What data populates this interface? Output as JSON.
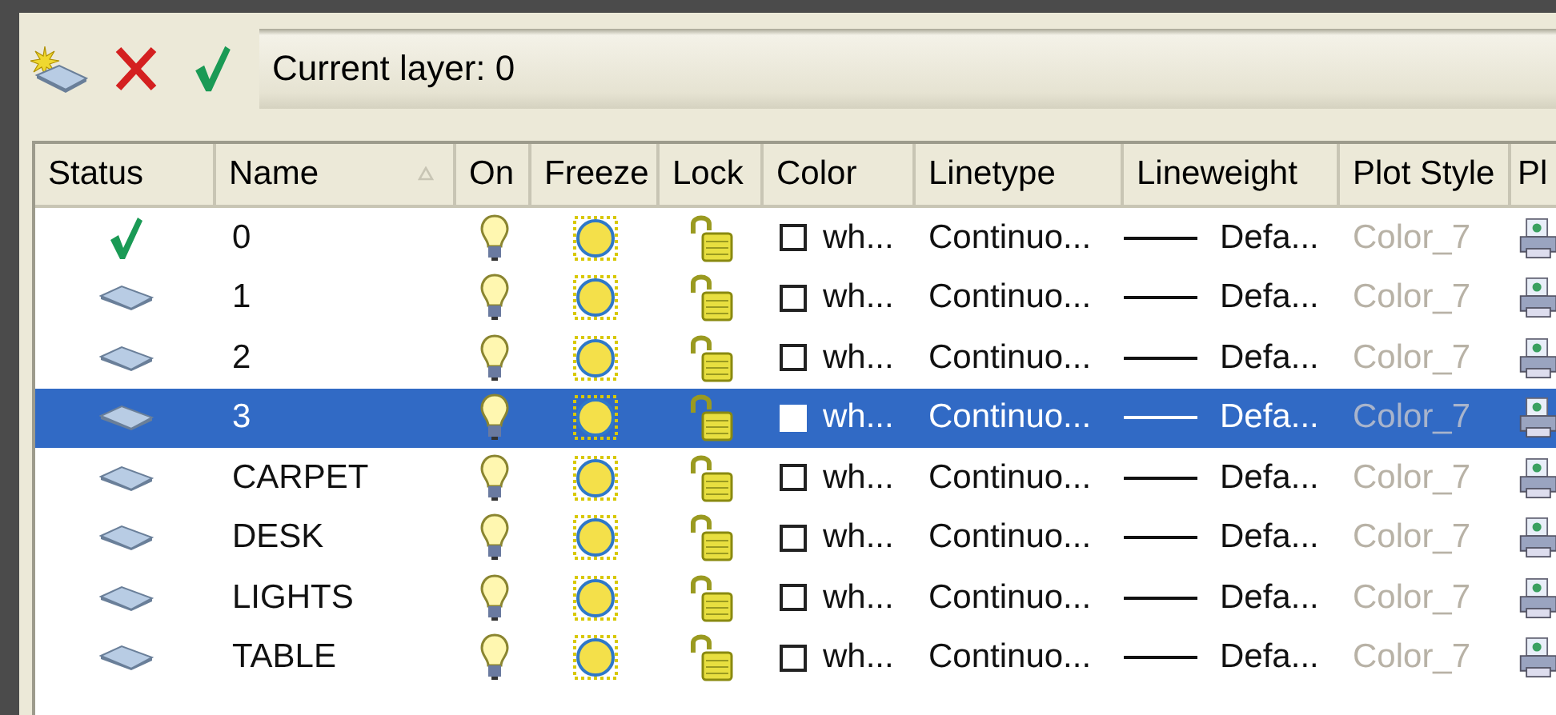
{
  "toolbar": {
    "current_layer": "Current layer: 0"
  },
  "table": {
    "columns": [
      {
        "label": "Status"
      },
      {
        "label": "Name",
        "sorted": true
      },
      {
        "label": "On"
      },
      {
        "label": "Freeze"
      },
      {
        "label": "Lock"
      },
      {
        "label": "Color"
      },
      {
        "label": "Linetype"
      },
      {
        "label": "Lineweight"
      },
      {
        "label": "Plot Style"
      },
      {
        "label": "Pl"
      }
    ],
    "rows": [
      {
        "kind": "current",
        "name": "0",
        "on": true,
        "frozen": false,
        "locked": false,
        "color_name": "wh...",
        "linetype": "Continuo...",
        "lineweight": "Defa...",
        "plot_style": "Color_7",
        "selected": false
      },
      {
        "kind": "layer",
        "name": "1",
        "on": true,
        "frozen": false,
        "locked": false,
        "color_name": "wh...",
        "linetype": "Continuo...",
        "lineweight": "Defa...",
        "plot_style": "Color_7",
        "selected": false
      },
      {
        "kind": "layer",
        "name": "2",
        "on": true,
        "frozen": false,
        "locked": false,
        "color_name": "wh...",
        "linetype": "Continuo...",
        "lineweight": "Defa...",
        "plot_style": "Color_7",
        "selected": false
      },
      {
        "kind": "layer",
        "name": "3",
        "on": true,
        "frozen": false,
        "locked": false,
        "color_name": "wh...",
        "linetype": "Continuo...",
        "lineweight": "Defa...",
        "plot_style": "Color_7",
        "selected": true
      },
      {
        "kind": "layer",
        "name": "CARPET",
        "on": true,
        "frozen": false,
        "locked": false,
        "color_name": "wh...",
        "linetype": "Continuo...",
        "lineweight": "Defa...",
        "plot_style": "Color_7",
        "selected": false
      },
      {
        "kind": "layer",
        "name": "DESK",
        "on": true,
        "frozen": false,
        "locked": false,
        "color_name": "wh...",
        "linetype": "Continuo...",
        "lineweight": "Defa...",
        "plot_style": "Color_7",
        "selected": false
      },
      {
        "kind": "layer",
        "name": "LIGHTS",
        "on": true,
        "frozen": false,
        "locked": false,
        "color_name": "wh...",
        "linetype": "Continuo...",
        "lineweight": "Defa...",
        "plot_style": "Color_7",
        "selected": false
      },
      {
        "kind": "layer",
        "name": "TABLE",
        "on": true,
        "frozen": false,
        "locked": false,
        "color_name": "wh...",
        "linetype": "Continuo...",
        "lineweight": "Defa...",
        "plot_style": "Color_7",
        "selected": false
      }
    ]
  }
}
